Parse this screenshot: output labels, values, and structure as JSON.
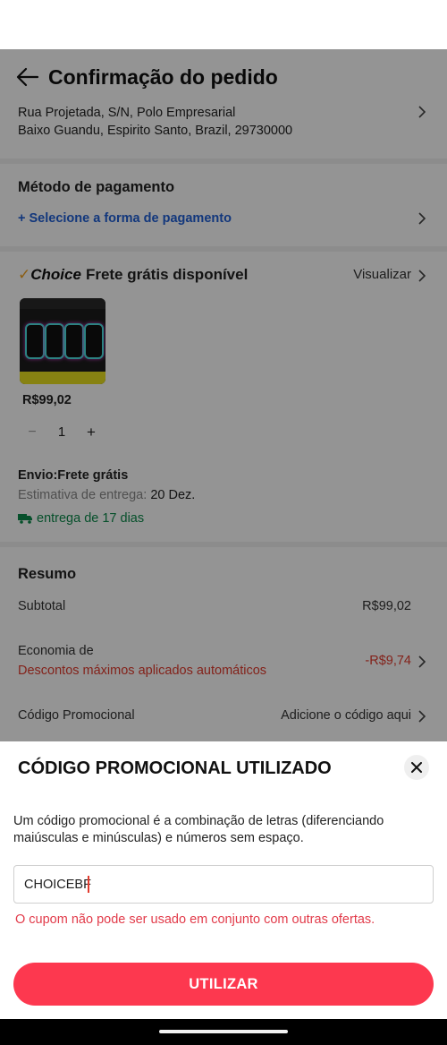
{
  "header": {
    "title": "Confirmação do pedido"
  },
  "address": {
    "line1": "Rua Projetada, S/N, Polo Empresarial",
    "line2": "Baixo Guandu, Espirito Santo, Brazil, 29730000"
  },
  "payment": {
    "title": "Método de pagamento",
    "select_label": "+ Selecione a forma de pagamento"
  },
  "choice": {
    "brand": "Choice",
    "free_shipping": "Frete grátis disponível",
    "view_label": "Visualizar",
    "product_price": "R$99,02",
    "quantity": "1",
    "minus_label": "−",
    "plus_label": "+",
    "shipping_title": "Envio:Frete grátis",
    "estimate_label": "Estimativa de entrega:",
    "estimate_date": "20 Dez.",
    "delivery_days": "entrega de 17 dias"
  },
  "summary": {
    "title": "Resumo",
    "subtotal_label": "Subtotal",
    "subtotal_value": "R$99,02",
    "savings_label": "Economia de",
    "savings_note": "Descontos máximos aplicados automáticos",
    "savings_value": "-R$9,74",
    "promo_label": "Código Promocional",
    "promo_action": "Adicione o código aqui"
  },
  "promo_sheet": {
    "title": "CÓDIGO PROMOCIONAL UTILIZADO",
    "close_label": "×",
    "description": "Um código promocional é a combinação de letras (diferenciando maiúsculas e minúsculas) e números sem espaço.",
    "input_value": "CHOICEBF",
    "error": "O cupom não pode ser usado em conjunto com outras ofertas.",
    "apply_label": "UTILIZAR"
  },
  "colors": {
    "accent": "#fd384f",
    "error": "#e23b4a",
    "link_blue": "#1f5fd6",
    "delivery_green": "#0c8a4a",
    "choice_gold": "#f0a020"
  },
  "icons": [
    "back-arrow-icon",
    "chevron-right-icon",
    "choice-check-icon",
    "truck-icon",
    "close-icon"
  ]
}
